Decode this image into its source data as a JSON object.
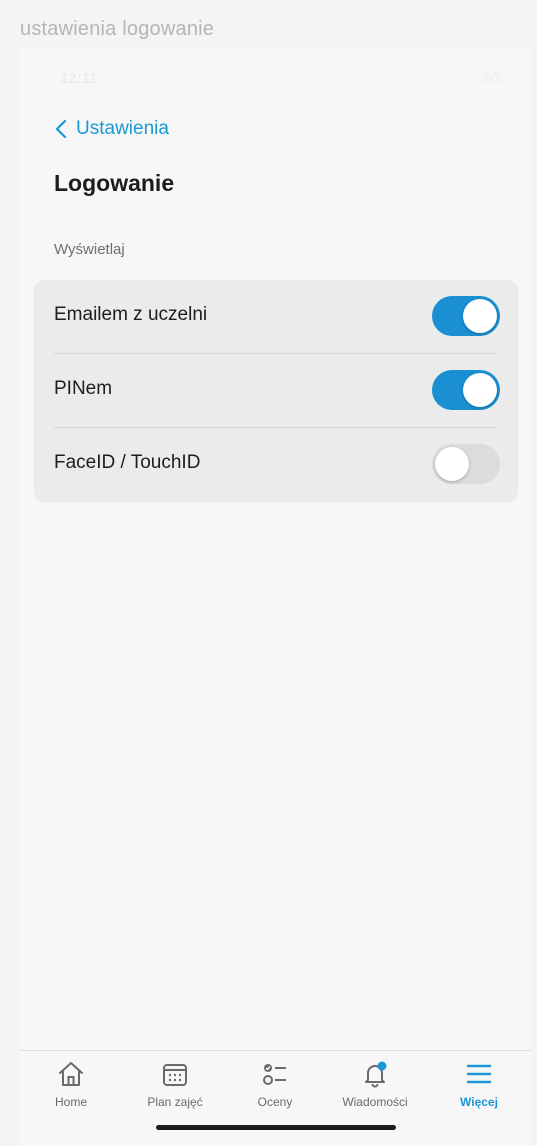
{
  "caption": "ustawienia logowanie",
  "status_bar": {
    "time": "12:11",
    "right": "5G"
  },
  "nav": {
    "back_label": "Ustawienia"
  },
  "page": {
    "title": "Logowanie",
    "section_label": "Wyświetlaj"
  },
  "settings": [
    {
      "label": "Emailem z uczelni",
      "enabled": true
    },
    {
      "label": "PINem",
      "enabled": true
    },
    {
      "label": "FaceID / TouchID",
      "enabled": false
    }
  ],
  "tabbar": {
    "tabs": [
      {
        "label": "Home",
        "icon": "home-icon",
        "active": false
      },
      {
        "label": "Plan zajęć",
        "icon": "calendar-icon",
        "active": false
      },
      {
        "label": "Oceny",
        "icon": "checklist-icon",
        "active": false
      },
      {
        "label": "Wiadomości",
        "icon": "bell-icon",
        "active": false
      },
      {
        "label": "Więcej",
        "icon": "menu-icon",
        "active": true
      }
    ]
  },
  "colors": {
    "accent": "#1a98d5",
    "toggle_on": "#1a8fd2",
    "toggle_off": "#dcdcdc",
    "card_bg": "#ebebeb"
  }
}
